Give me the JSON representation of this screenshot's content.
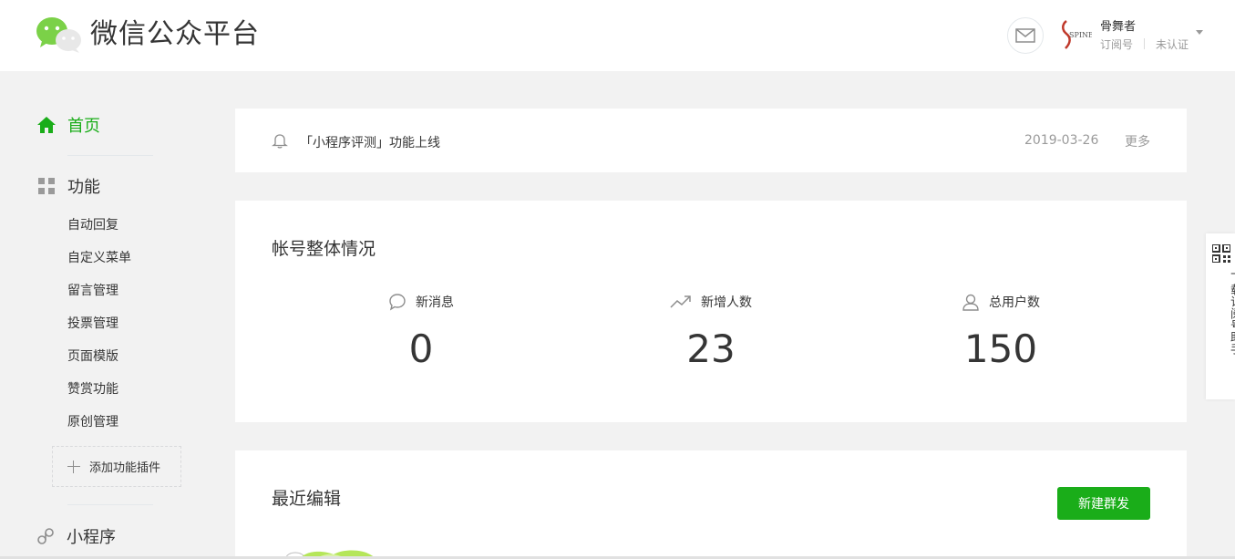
{
  "header": {
    "brand": "微信公众平台",
    "account_name": "骨舞者",
    "account_type": "订阅号",
    "account_status": "未认证",
    "account_logo_text": "SPINE"
  },
  "sidebar": {
    "home": "首页",
    "function": "功能",
    "items": [
      "自动回复",
      "自定义菜单",
      "留言管理",
      "投票管理",
      "页面模版",
      "赞赏功能",
      "原创管理"
    ],
    "add_plugin": "添加功能插件",
    "mini_program": "小程序"
  },
  "notice": {
    "text": "「小程序评测」功能上线",
    "date": "2019-03-26",
    "more": "更多"
  },
  "overview": {
    "title": "帐号整体情况",
    "stats": [
      {
        "label": "新消息",
        "value": "0",
        "icon": "chat-bubble-icon"
      },
      {
        "label": "新增人数",
        "value": "23",
        "icon": "trend-up-icon"
      },
      {
        "label": "总用户数",
        "value": "150",
        "icon": "user-icon"
      }
    ]
  },
  "recent": {
    "title": "最近编辑",
    "new_broadcast": "新建群发"
  },
  "helper": {
    "text": "下载订阅号助手"
  },
  "colors": {
    "accent": "#1aad19",
    "text": "#353535",
    "muted": "#9a9a9a",
    "background": "#f2f2f2"
  }
}
